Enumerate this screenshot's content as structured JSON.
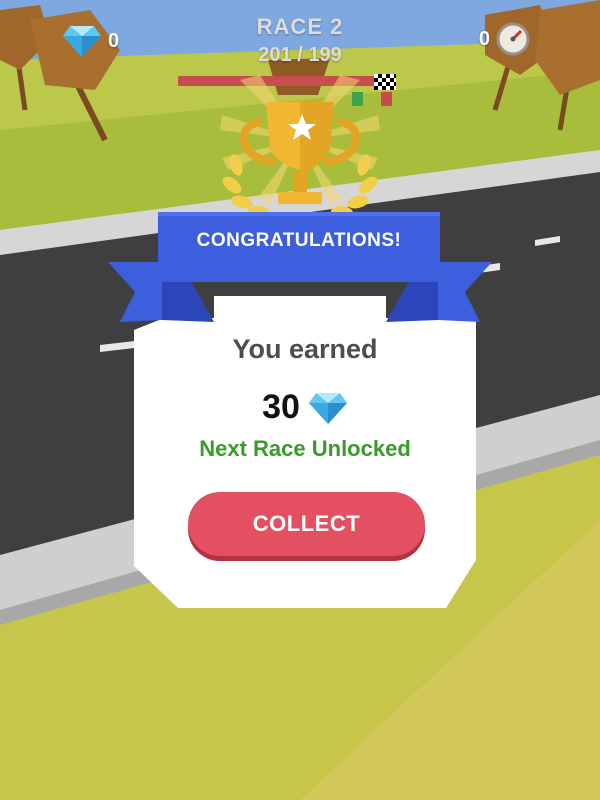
{
  "hud": {
    "gems": "0",
    "speed": "0",
    "race_title": "RACE 2",
    "race_progress": "201 / 199",
    "race_progress_fraction": 0.95
  },
  "dialog": {
    "banner_title": "CONGRATULATIONS!",
    "earned_label": "You earned",
    "reward_amount": "30",
    "reward_icon": "diamond-icon",
    "unlocked_text": "Next Race Unlocked",
    "collect_label": "COLLECT"
  },
  "colors": {
    "banner": "#3d5fdd",
    "button": "#e25061",
    "unlocked": "#3a9a2b",
    "trophy": "#f2b731"
  }
}
